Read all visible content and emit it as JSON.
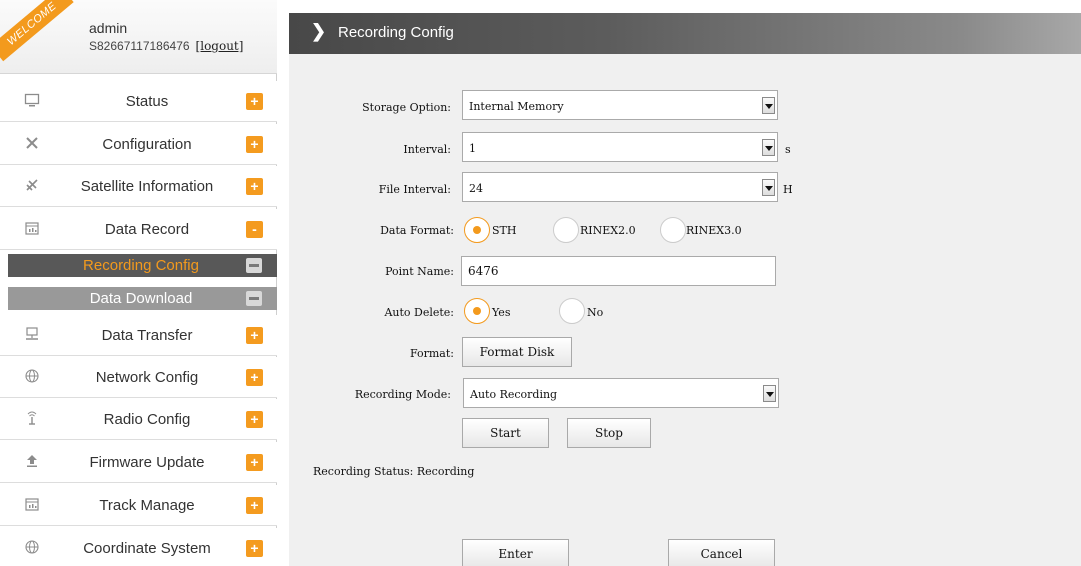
{
  "user": {
    "welcome": "WELCOME",
    "name": "admin",
    "serial": "S82667117186476",
    "logout": "[logout]"
  },
  "sidebar": {
    "items": [
      {
        "label": "Status",
        "icon": "monitor-icon",
        "toggle": "+"
      },
      {
        "label": "Configuration",
        "icon": "tools-icon",
        "toggle": "+"
      },
      {
        "label": "Satellite Information",
        "icon": "satellite-icon",
        "toggle": "+"
      },
      {
        "label": "Data Record",
        "icon": "calendar-chart-icon",
        "toggle": "-"
      },
      {
        "label": "Data Transfer",
        "icon": "network-icon",
        "toggle": "+"
      },
      {
        "label": "Network Config",
        "icon": "globe-icon",
        "toggle": "+"
      },
      {
        "label": "Radio Config",
        "icon": "antenna-icon",
        "toggle": "+"
      },
      {
        "label": "Firmware Update",
        "icon": "upload-icon",
        "toggle": "+"
      },
      {
        "label": "Track Manage",
        "icon": "calendar-chart-icon",
        "toggle": "+"
      },
      {
        "label": "Coordinate System",
        "icon": "globe-icon",
        "toggle": "+"
      }
    ],
    "sub_items": [
      {
        "label": "Recording Config",
        "active": true
      },
      {
        "label": "Data Download",
        "active": false
      }
    ]
  },
  "main": {
    "title": "Recording Config",
    "form": {
      "storage_option": {
        "label": "Storage Option:",
        "value": "Internal Memory"
      },
      "interval": {
        "label": "Interval:",
        "value": "1",
        "unit": "s"
      },
      "file_interval": {
        "label": "File Interval:",
        "value": "24",
        "unit": "H"
      },
      "data_format": {
        "label": "Data Format:",
        "options": [
          "STH",
          "RINEX2.0",
          "RINEX3.0"
        ],
        "selected": "STH"
      },
      "point_name": {
        "label": "Point Name:",
        "value": "6476"
      },
      "auto_delete": {
        "label": "Auto Delete:",
        "options": [
          "Yes",
          "No"
        ],
        "selected": "Yes"
      },
      "format": {
        "label": "Format:",
        "button": "Format Disk"
      },
      "recording_mode": {
        "label": "Recording Mode:",
        "value": "Auto Recording"
      },
      "start_button": "Start",
      "stop_button": "Stop",
      "recording_status": {
        "label": "Recording Status:",
        "value": "Recording"
      }
    },
    "enter_button": "Enter",
    "cancel_button": "Cancel"
  },
  "colors": {
    "accent": "#f39a1d",
    "title_bar": "#4f4f4f",
    "sub_active_bg": "#585858",
    "sub_inactive_bg": "#999999"
  }
}
